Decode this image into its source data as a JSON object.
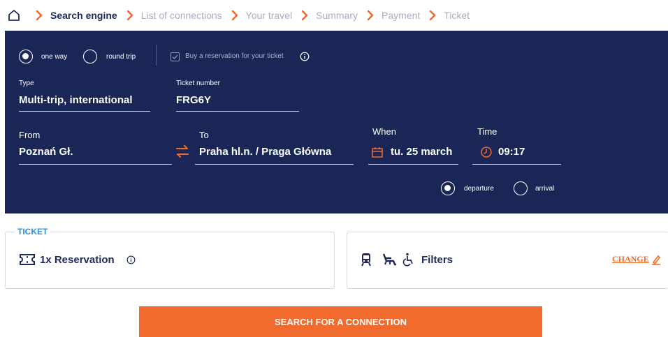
{
  "breadcrumb": {
    "steps": [
      {
        "label": "Search engine",
        "active": true
      },
      {
        "label": "List of connections"
      },
      {
        "label": "Your travel"
      },
      {
        "label": "Summary"
      },
      {
        "label": "Payment"
      },
      {
        "label": "Ticket"
      }
    ]
  },
  "trip_type": {
    "one_way": "one way",
    "round_trip": "round trip",
    "selected": "one way"
  },
  "reservation_checkbox": {
    "label": "Buy a reservation for your ticket",
    "checked": false
  },
  "type": {
    "label": "Type",
    "value": "Multi-trip, international"
  },
  "ticket_number": {
    "label": "Ticket number",
    "value": "FRG6Y"
  },
  "from": {
    "label": "From",
    "value": "Poznań Gł."
  },
  "to": {
    "label": "To",
    "value": "Praha hl.n. / Praga Główna"
  },
  "when": {
    "label": "When",
    "value": "tu. 25 march"
  },
  "time": {
    "label": "Time",
    "value": "09:17"
  },
  "time_mode": {
    "departure": "departure",
    "arrival": "arrival",
    "selected": "departure"
  },
  "ticket_card": {
    "legend": "TICKET",
    "value": "1x Reservation"
  },
  "filters_card": {
    "label": "Filters",
    "change": "CHANGE"
  },
  "search_button": "SEARCH FOR A CONNECTION",
  "colors": {
    "navy": "#1a2756",
    "accent": "#f26b2e",
    "legend": "#2f8fd8"
  }
}
